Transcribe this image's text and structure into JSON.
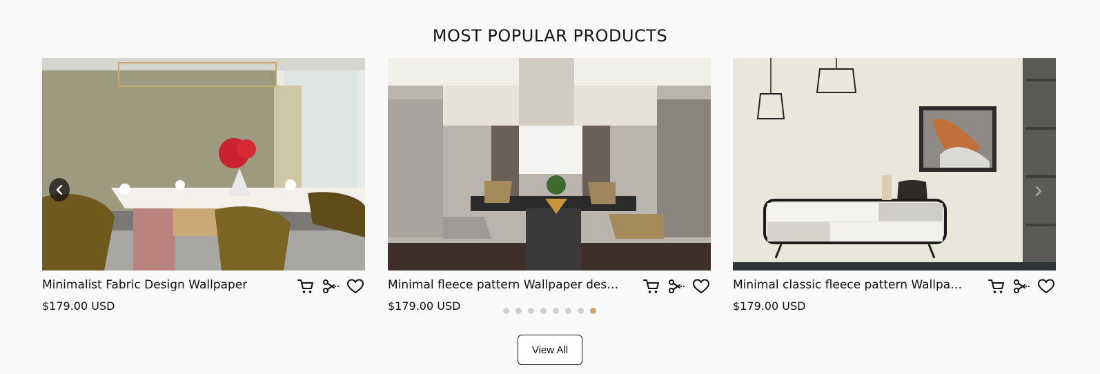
{
  "section": {
    "title": "MOST POPULAR PRODUCTS"
  },
  "products": [
    {
      "name": "Minimalist Fabric Design Wallpaper",
      "price": "$179.00 USD"
    },
    {
      "name": "Minimal fleece pattern Wallpaper design",
      "price": "$179.00 USD"
    },
    {
      "name": "Minimal classic fleece pattern Wallpaper...",
      "price": "$179.00 USD"
    }
  ],
  "carousel": {
    "dot_count": 8,
    "active_dot": 8
  },
  "view_all_label": "View All",
  "colors": {
    "accent_dot": "#c9a96b",
    "inactive_dot": "#cfcfcf",
    "text": "#111111"
  },
  "icons": [
    "chevron-left-icon",
    "chevron-right-icon",
    "cart-icon",
    "scissors-icon",
    "heart-icon"
  ]
}
